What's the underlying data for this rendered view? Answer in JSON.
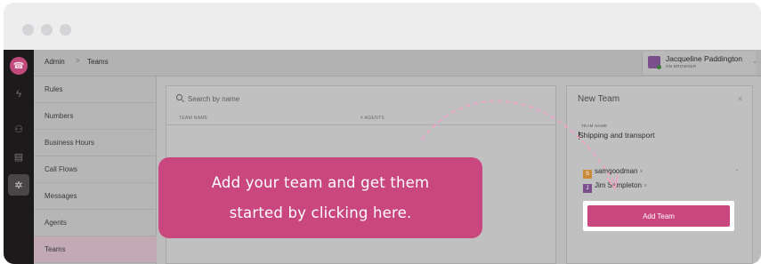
{
  "window": {
    "controls": [
      "close",
      "minimize",
      "maximize"
    ],
    "colors": {
      "dot": "#d4d4d6",
      "titlebar": "#ededee"
    }
  },
  "rail": {
    "items": [
      {
        "icon": "phone-icon",
        "glyph": "☎"
      },
      {
        "icon": "bolt-icon",
        "glyph": "ϟ"
      },
      {
        "icon": "team-icon",
        "glyph": "⚇"
      },
      {
        "icon": "inbox-icon",
        "glyph": "▤"
      },
      {
        "icon": "gear-icon",
        "glyph": "✲"
      }
    ]
  },
  "header": {
    "breadcrumb": {
      "root": "Admin",
      "separator": ">",
      "current": "Teams"
    },
    "user": {
      "name": "Jacqueline Paddington",
      "status": "ON BROWSER"
    }
  },
  "nav": {
    "items": [
      {
        "label": "Rules"
      },
      {
        "label": "Numbers"
      },
      {
        "label": "Business Hours"
      },
      {
        "label": "Call Flows"
      },
      {
        "label": "Messages"
      },
      {
        "label": "Agents"
      },
      {
        "label": "Teams",
        "active": true
      }
    ]
  },
  "team_list": {
    "search_placeholder": "Search by name",
    "columns": [
      "TEAM NAME",
      "# AGENTS"
    ]
  },
  "new_team": {
    "title": "New Team",
    "close_glyph": "×",
    "field_label": "TEAM NAME",
    "field_value": "Shipping and transport",
    "agents": [
      {
        "initial": "S",
        "name": "samgoodman",
        "avatar_color": "#c98a3a"
      },
      {
        "initial": "J",
        "name": "Jim Sampleton",
        "avatar_color": "#7b4f8c"
      }
    ],
    "remove_glyph": "×",
    "submit_label": "Add Team"
  },
  "callout": {
    "line1": "Add your team and get them",
    "line2": "started by clicking here."
  },
  "colors": {
    "accent": "#c9467f",
    "arrow": "#f2a1c3"
  }
}
